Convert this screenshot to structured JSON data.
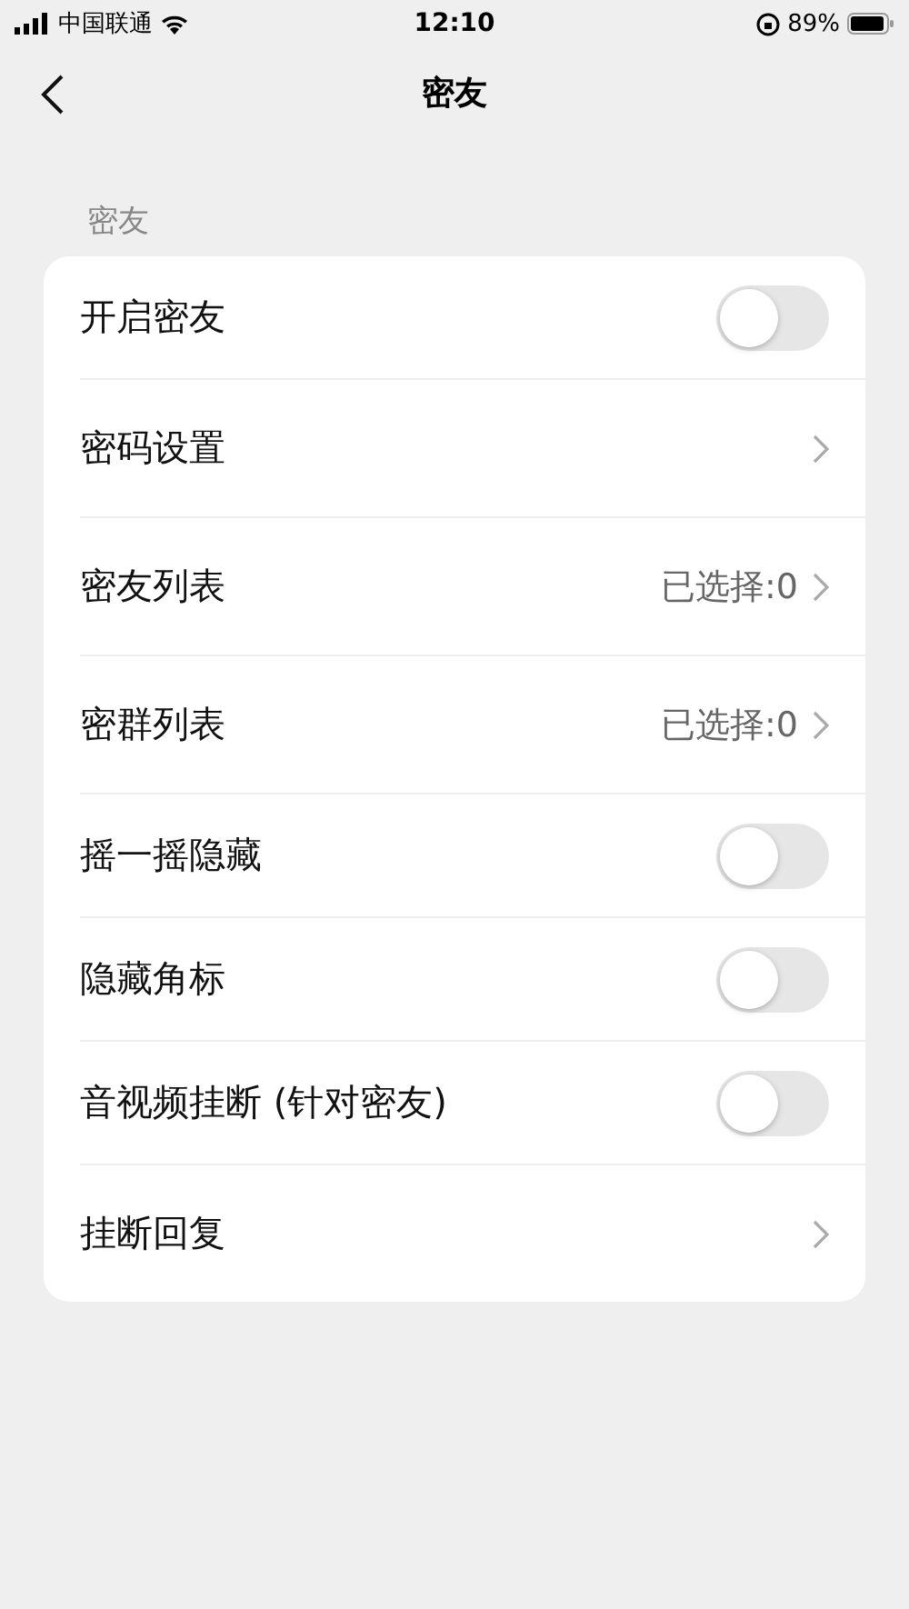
{
  "status_bar": {
    "carrier": "中国联通",
    "time": "12:10",
    "battery": "89%"
  },
  "nav": {
    "title": "密友"
  },
  "section": {
    "title": "密友"
  },
  "rows": [
    {
      "kind": "toggle",
      "label": "开启密友",
      "on": false
    },
    {
      "kind": "link",
      "label": "密码设置"
    },
    {
      "kind": "link",
      "label": "密友列表",
      "value": "已选择:0"
    },
    {
      "kind": "link",
      "label": "密群列表",
      "value": "已选择:0"
    },
    {
      "kind": "toggle",
      "label": "摇一摇隐藏",
      "on": false
    },
    {
      "kind": "toggle",
      "label": "隐藏角标",
      "on": false
    },
    {
      "kind": "toggle",
      "label": "音视频挂断 (针对密友)",
      "on": false
    },
    {
      "kind": "link",
      "label": "挂断回复"
    }
  ]
}
